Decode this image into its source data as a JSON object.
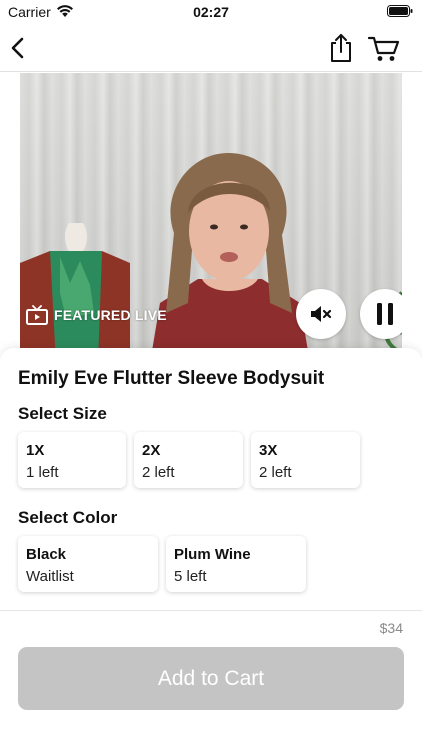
{
  "status_bar": {
    "carrier": "Carrier",
    "time": "02:27",
    "icons": [
      "wifi-icon",
      "battery-icon"
    ]
  },
  "nav": {
    "icons": [
      "chevron-left-icon",
      "share-icon",
      "cart-icon"
    ]
  },
  "video": {
    "badge_label": "FEATURED LIVE",
    "icons": [
      "tv-icon",
      "mute-icon",
      "pause-icon"
    ]
  },
  "product": {
    "title": "Emily Eve Flutter Sleeve Bodysuit",
    "size_section_label": "Select Size",
    "sizes": [
      {
        "name": "1X",
        "stock": "1 left"
      },
      {
        "name": "2X",
        "stock": "2 left"
      },
      {
        "name": "3X",
        "stock": "2 left"
      }
    ],
    "color_section_label": "Select Color",
    "colors": [
      {
        "name": "Black",
        "stock": "Waitlist"
      },
      {
        "name": "Plum Wine",
        "stock": "5 left"
      }
    ]
  },
  "footer": {
    "price": "$34",
    "add_to_cart_label": "Add to Cart",
    "button_color": "#c4c4c4"
  }
}
